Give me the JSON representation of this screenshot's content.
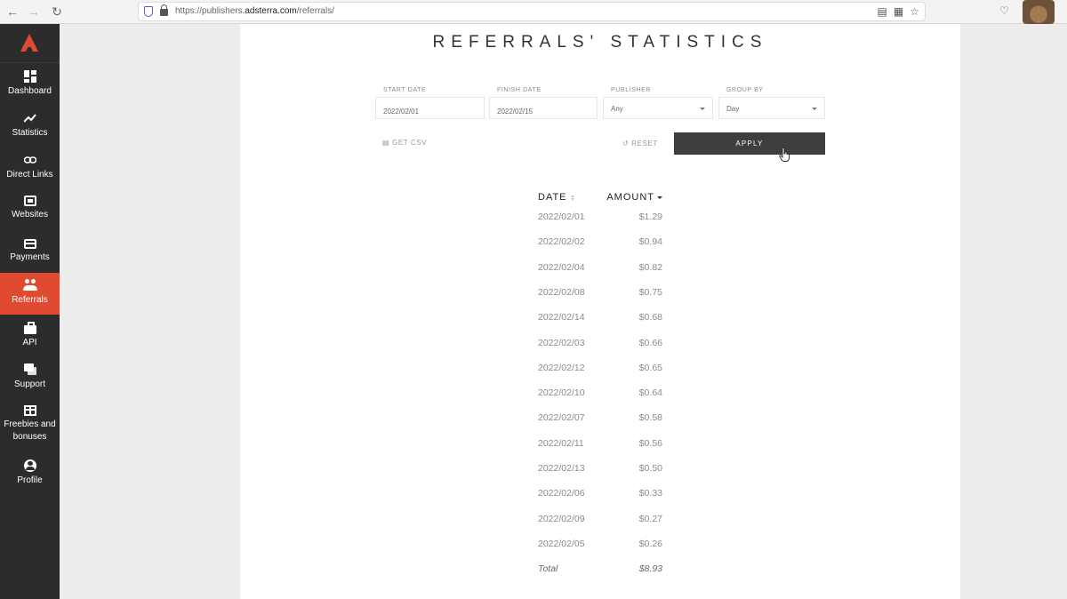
{
  "browser": {
    "url_prefix": "https://publishers.",
    "url_domain": "adsterra.com",
    "url_path": "/referrals/"
  },
  "sidebar": {
    "brand_color": "#e04a30",
    "items": [
      {
        "label": "Dashboard",
        "icon": "dashboard-icon"
      },
      {
        "label": "Statistics",
        "icon": "chart-icon"
      },
      {
        "label": "Direct Links",
        "icon": "link-icon"
      },
      {
        "label": "Websites",
        "icon": "website-icon"
      },
      {
        "label": "Payments",
        "icon": "card-icon"
      },
      {
        "label": "Referrals",
        "icon": "people-icon",
        "active": true
      },
      {
        "label": "API",
        "icon": "briefcase-icon"
      },
      {
        "label": "Support",
        "icon": "chat-icon"
      },
      {
        "label": "Freebies and bonuses",
        "icon": "gift-icon"
      },
      {
        "label": "Profile",
        "icon": "user-icon"
      }
    ]
  },
  "page": {
    "title": "REFERRALS' STATISTICS"
  },
  "filters": {
    "start_date": {
      "label": "START DATE",
      "value": "2022/02/01"
    },
    "finish_date": {
      "label": "FINISH DATE",
      "value": "2022/02/15"
    },
    "publisher": {
      "label": "PUBLISHER",
      "value": "Any"
    },
    "group_by": {
      "label": "GROUP BY",
      "value": "Day"
    },
    "get_csv": "GET CSV",
    "reset": "RESET",
    "apply": "APPLY"
  },
  "table": {
    "columns": [
      "DATE",
      "AMOUNT"
    ],
    "rows": [
      {
        "date": "2022/02/01",
        "amount": "$1.29"
      },
      {
        "date": "2022/02/02",
        "amount": "$0.94"
      },
      {
        "date": "2022/02/04",
        "amount": "$0.82"
      },
      {
        "date": "2022/02/08",
        "amount": "$0.75"
      },
      {
        "date": "2022/02/14",
        "amount": "$0.68"
      },
      {
        "date": "2022/02/03",
        "amount": "$0.66"
      },
      {
        "date": "2022/02/12",
        "amount": "$0.65"
      },
      {
        "date": "2022/02/10",
        "amount": "$0.64"
      },
      {
        "date": "2022/02/07",
        "amount": "$0.58"
      },
      {
        "date": "2022/02/11",
        "amount": "$0.56"
      },
      {
        "date": "2022/02/13",
        "amount": "$0.50"
      },
      {
        "date": "2022/02/06",
        "amount": "$0.33"
      },
      {
        "date": "2022/02/09",
        "amount": "$0.27"
      },
      {
        "date": "2022/02/05",
        "amount": "$0.26"
      }
    ],
    "total": {
      "label": "Total",
      "amount": "$8.93"
    }
  }
}
